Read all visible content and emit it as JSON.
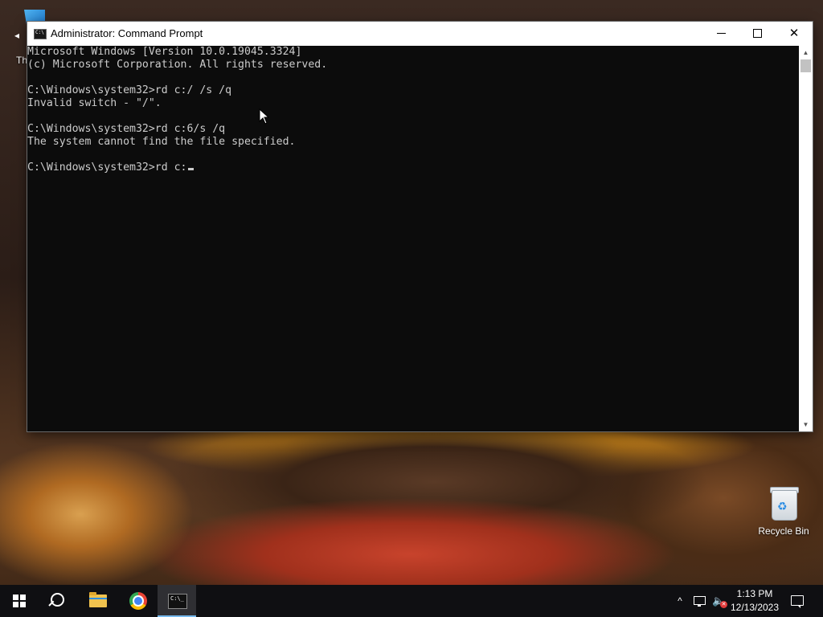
{
  "desktop": {
    "left_icon_label": "Th",
    "recycle_bin_label": "Recycle Bin"
  },
  "window": {
    "title": "Administrator: Command Prompt",
    "controls": {
      "minimize": "minimize",
      "maximize": "maximize",
      "close": "close"
    }
  },
  "console": {
    "lines": [
      "Microsoft Windows [Version 10.0.19045.3324]",
      "(c) Microsoft Corporation. All rights reserved.",
      "",
      "C:\\Windows\\system32>rd c:/ /s /q",
      "Invalid switch - \"/\".",
      "",
      "C:\\Windows\\system32>rd c:6/s /q",
      "The system cannot find the file specified.",
      ""
    ],
    "prompt_line": "C:\\Windows\\system32>rd c:"
  },
  "taskbar": {
    "icons": [
      "windows-start-icon",
      "search-icon",
      "file-explorer-icon",
      "chrome-icon",
      "command-prompt-icon"
    ],
    "tray": {
      "chevron": "^",
      "time": "1:13 PM",
      "date": "12/13/2023"
    }
  },
  "colors": {
    "console_bg": "#0c0c0c",
    "console_fg": "#cccccc",
    "taskbar_bg": "#0f0f12",
    "active_indicator": "#76b9ed"
  }
}
